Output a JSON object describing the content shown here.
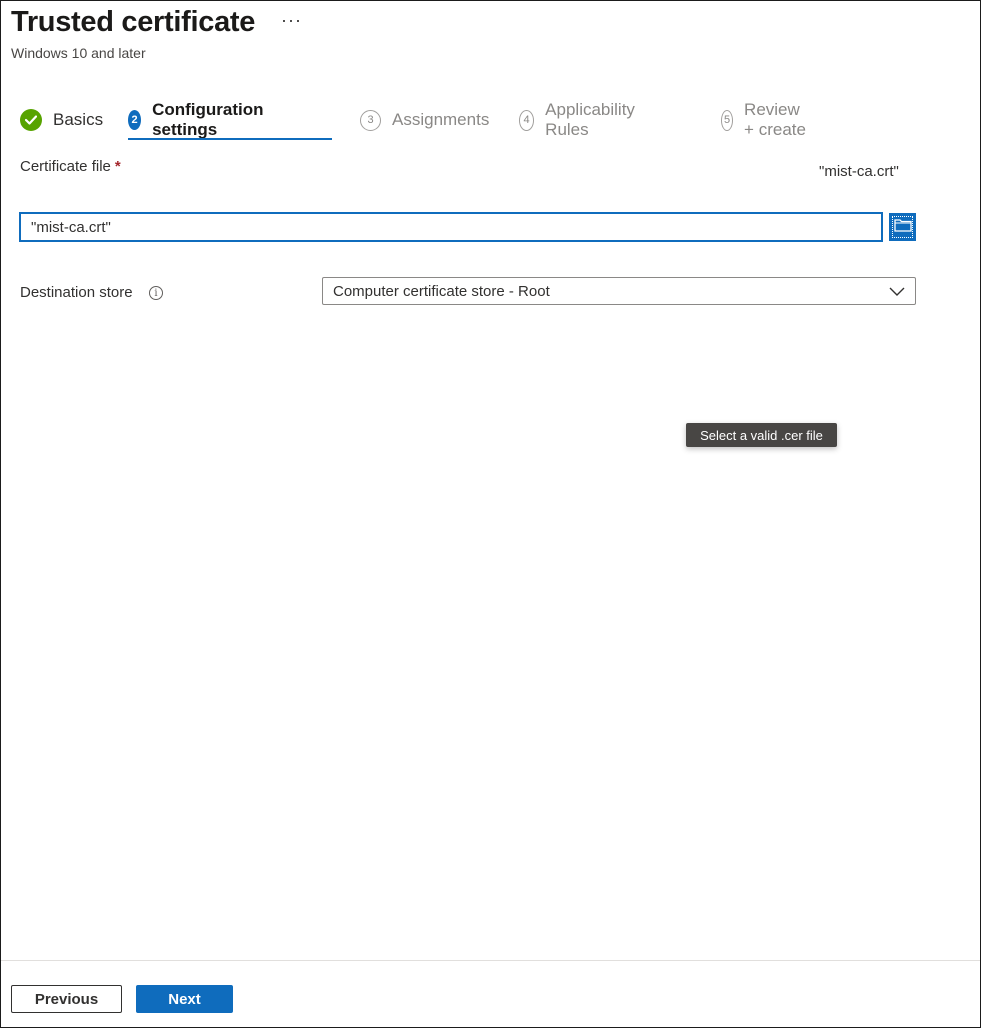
{
  "header": {
    "title": "Trusted certificate",
    "more_label": "···",
    "subtitle": "Windows 10 and later"
  },
  "steps": [
    {
      "number": "",
      "label": "Basics",
      "state": "done"
    },
    {
      "number": "2",
      "label": "Configuration settings",
      "state": "active"
    },
    {
      "number": "3",
      "label": "Assignments",
      "state": "pending"
    },
    {
      "number": "4",
      "label": "Applicability Rules",
      "state": "pending"
    },
    {
      "number": "5",
      "label": "Review + create",
      "state": "pending"
    }
  ],
  "form": {
    "certificate_file": {
      "label": "Certificate file",
      "required_mark": "*",
      "selected_value": "\"mist-ca.crt\"",
      "input_value": "\"mist-ca.crt\"",
      "browse_icon": "folder-icon"
    },
    "destination_store": {
      "label": "Destination store",
      "info_icon": "info-icon",
      "info_glyph": "i",
      "selected": "Computer certificate store - Root"
    }
  },
  "tooltip": {
    "text": "Select a valid .cer file"
  },
  "footer": {
    "previous_label": "Previous",
    "next_label": "Next"
  },
  "colors": {
    "accent": "#0f6cbd",
    "success": "#57a300",
    "required": "#a4262c",
    "tooltip_bg": "#484644"
  }
}
